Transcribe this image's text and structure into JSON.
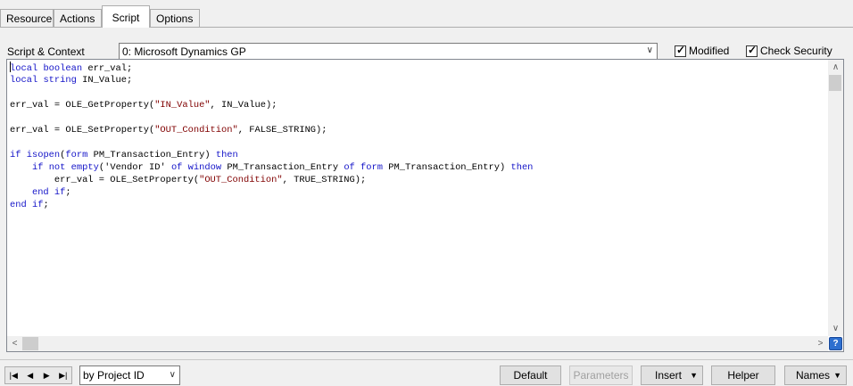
{
  "tabs": [
    "Resource",
    "Actions",
    "Script",
    "Options"
  ],
  "active_tab": "Script",
  "context": {
    "label": "Script & Context",
    "selected": "0: Microsoft Dynamics GP"
  },
  "checkboxes": {
    "modified": {
      "label": "Modified",
      "checked": true
    },
    "check_security": {
      "label": "Check Security",
      "checked": true
    }
  },
  "code_lines": [
    "local boolean err_val;",
    "local string IN_Value;",
    "",
    "err_val = OLE_GetProperty(\"IN_Value\", IN_Value);",
    "",
    "err_val = OLE_SetProperty(\"OUT_Condition\", FALSE_STRING);",
    "",
    "if isopen(form PM_Transaction_Entry) then",
    "    if not empty('Vendor ID' of window PM_Transaction_Entry of form PM_Transaction_Entry) then",
    "        err_val = OLE_SetProperty(\"OUT_Condition\", TRUE_STRING);",
    "    end if;",
    "end if;"
  ],
  "keywords": [
    "local",
    "boolean",
    "string",
    "if",
    "isopen",
    "form",
    "then",
    "not",
    "empty",
    "of",
    "window",
    "end"
  ],
  "help_icon": "?",
  "bottom": {
    "nav_icons": [
      "first-icon",
      "prev-icon",
      "next-icon",
      "last-icon"
    ],
    "sort_selected": "by Project ID",
    "buttons": {
      "default": "Default",
      "parameters": "Parameters",
      "insert": "Insert",
      "helper": "Helper",
      "names": "Names"
    }
  }
}
